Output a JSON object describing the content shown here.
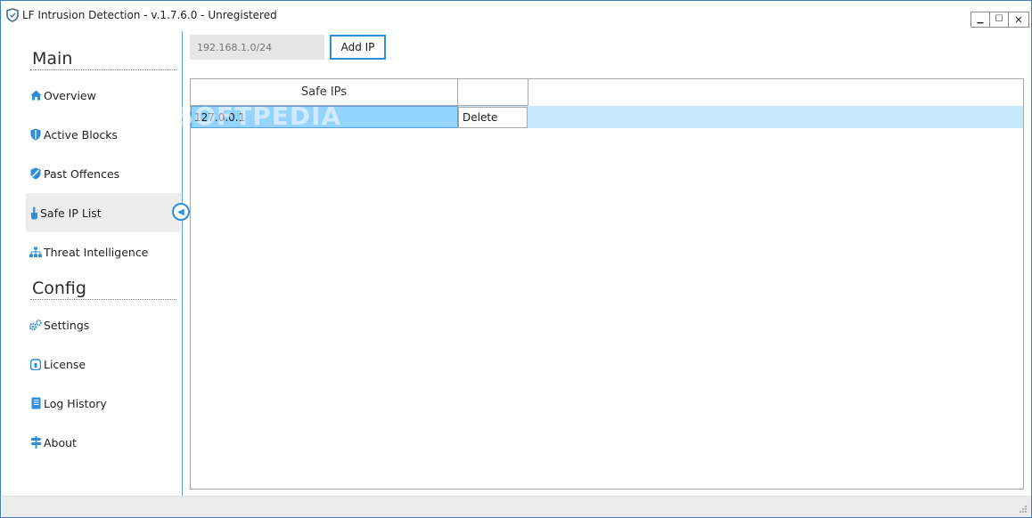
{
  "window": {
    "title": "LF Intrusion Detection - v.1.7.6.0 - Unregistered",
    "minimize_label": "▁",
    "maximize_label": "☐",
    "close_label": "✕"
  },
  "sidebar": {
    "sections": [
      {
        "label": "Main"
      },
      {
        "label": "Config"
      }
    ],
    "items": [
      {
        "label": "Overview",
        "icon": "home-icon"
      },
      {
        "label": "Active Blocks",
        "icon": "shield-icon"
      },
      {
        "label": "Past Offences",
        "icon": "shield-slash-icon"
      },
      {
        "label": "Safe IP List",
        "icon": "hand-icon",
        "active": true
      },
      {
        "label": "Threat Intelligence",
        "icon": "network-icon"
      },
      {
        "label": "Settings",
        "icon": "gears-icon"
      },
      {
        "label": "License",
        "icon": "lock-icon"
      },
      {
        "label": "Log History",
        "icon": "book-icon"
      },
      {
        "label": "About",
        "icon": "signpost-icon"
      }
    ]
  },
  "toolbar": {
    "ip_placeholder": "192.168.1.0/24",
    "add_ip_label": "Add IP"
  },
  "grid": {
    "columns": [
      "Safe IPs",
      ""
    ],
    "rows": [
      {
        "ip": "127.0.0.1",
        "action": "Delete"
      }
    ]
  },
  "watermark": "SOFTPEDIA",
  "colors": {
    "accent": "#2f8fd6",
    "row_selected": "#94d3fb",
    "row_highlight": "#c6e8fb",
    "sidebar_active": "#ededed"
  }
}
